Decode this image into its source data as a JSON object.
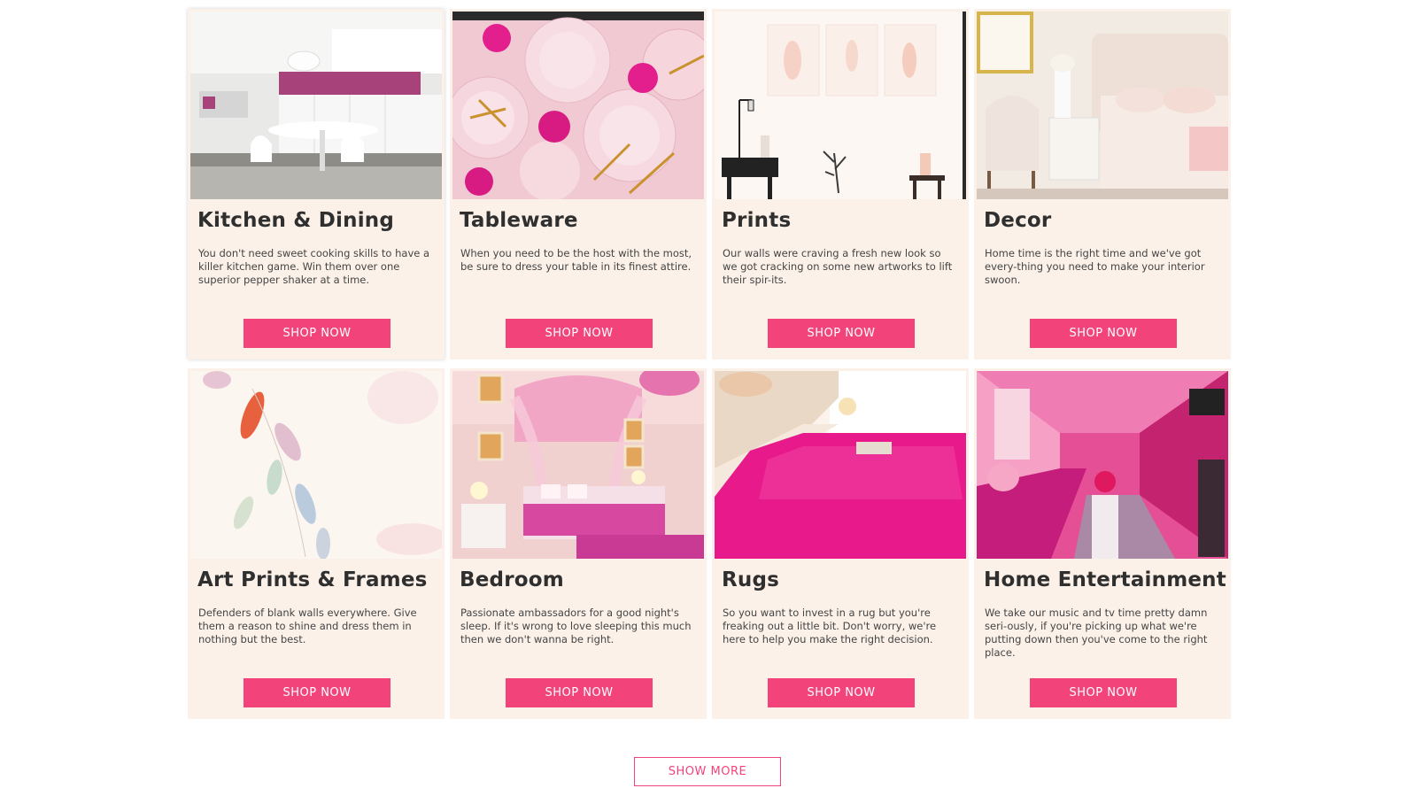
{
  "categories": [
    {
      "title": "Kitchen & Dining",
      "description": "You don't need sweet cooking skills to have a killer kitchen game. Win them over one superior pepper shaker at a time.",
      "button": "SHOP NOW"
    },
    {
      "title": "Tableware",
      "description": "When you need to be the host with the most, be sure to dress your table in its finest attire.",
      "button": "SHOP NOW"
    },
    {
      "title": "Prints",
      "description": "Our walls were craving a fresh new look so we got cracking on some new artworks to lift their spir-its.",
      "button": "SHOP NOW"
    },
    {
      "title": "Decor",
      "description": "Home time is the right time and we've got every-thing you need to make your interior swoon.",
      "button": "SHOP NOW"
    },
    {
      "title": "Art Prints & Frames",
      "description": "Defenders of blank walls everywhere. Give them a reason to shine and dress them in nothing but the best.",
      "button": "SHOP NOW"
    },
    {
      "title": "Bedroom",
      "description": "Passionate ambassadors for a good night's sleep. If it's wrong to love sleeping this much then we don't wanna be right.",
      "button": "SHOP NOW"
    },
    {
      "title": "Rugs",
      "description": "So you want to invest in a rug but you're freaking out a little bit. Don't worry, we're here to help you make the right decision.",
      "button": "SHOP NOW"
    },
    {
      "title": "Home Entertainment",
      "description": "We take our music and tv time pretty damn seri-ously, if you're picking up what we're putting down then you've come to the right place.",
      "button": "SHOP NOW"
    }
  ],
  "show_more": "SHOW MORE",
  "colors": {
    "accent": "#f2447b",
    "card_bg": "#fbf1e9"
  }
}
